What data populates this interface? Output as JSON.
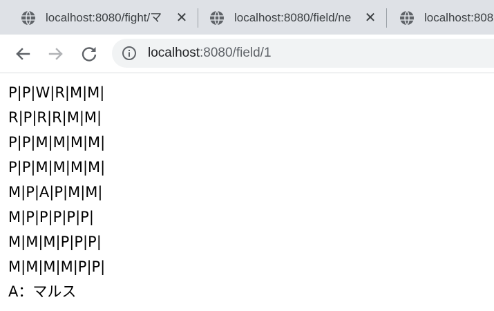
{
  "browser": {
    "tabs": [
      {
        "title": "localhost:8080/fight/マ"
      },
      {
        "title": "localhost:8080/field/ne"
      },
      {
        "title": "localhost:808"
      }
    ],
    "close_glyph": "✕",
    "url_host": "localhost",
    "url_path": ":8080/field/1"
  },
  "page": {
    "rows": [
      "P|P|W|R|M|M|",
      "R|P|R|R|M|M|",
      "P|P|M|M|M|M|",
      "P|P|M|M|M|M|",
      "M|P|A|P|M|M|",
      "M|P|P|P|P|P|",
      "M|M|M|P|P|P|",
      "M|M|M|M|P|P|"
    ],
    "legend": "A：マルス"
  },
  "colors": {
    "tabstrip": "#dee1e6",
    "omnibox": "#f1f3f4",
    "icon": "#5f6368",
    "icon_disabled": "#b1b3b6"
  },
  "icons": [
    "globe-icon",
    "close-icon",
    "back-arrow-icon",
    "forward-arrow-icon",
    "reload-icon",
    "info-icon"
  ]
}
